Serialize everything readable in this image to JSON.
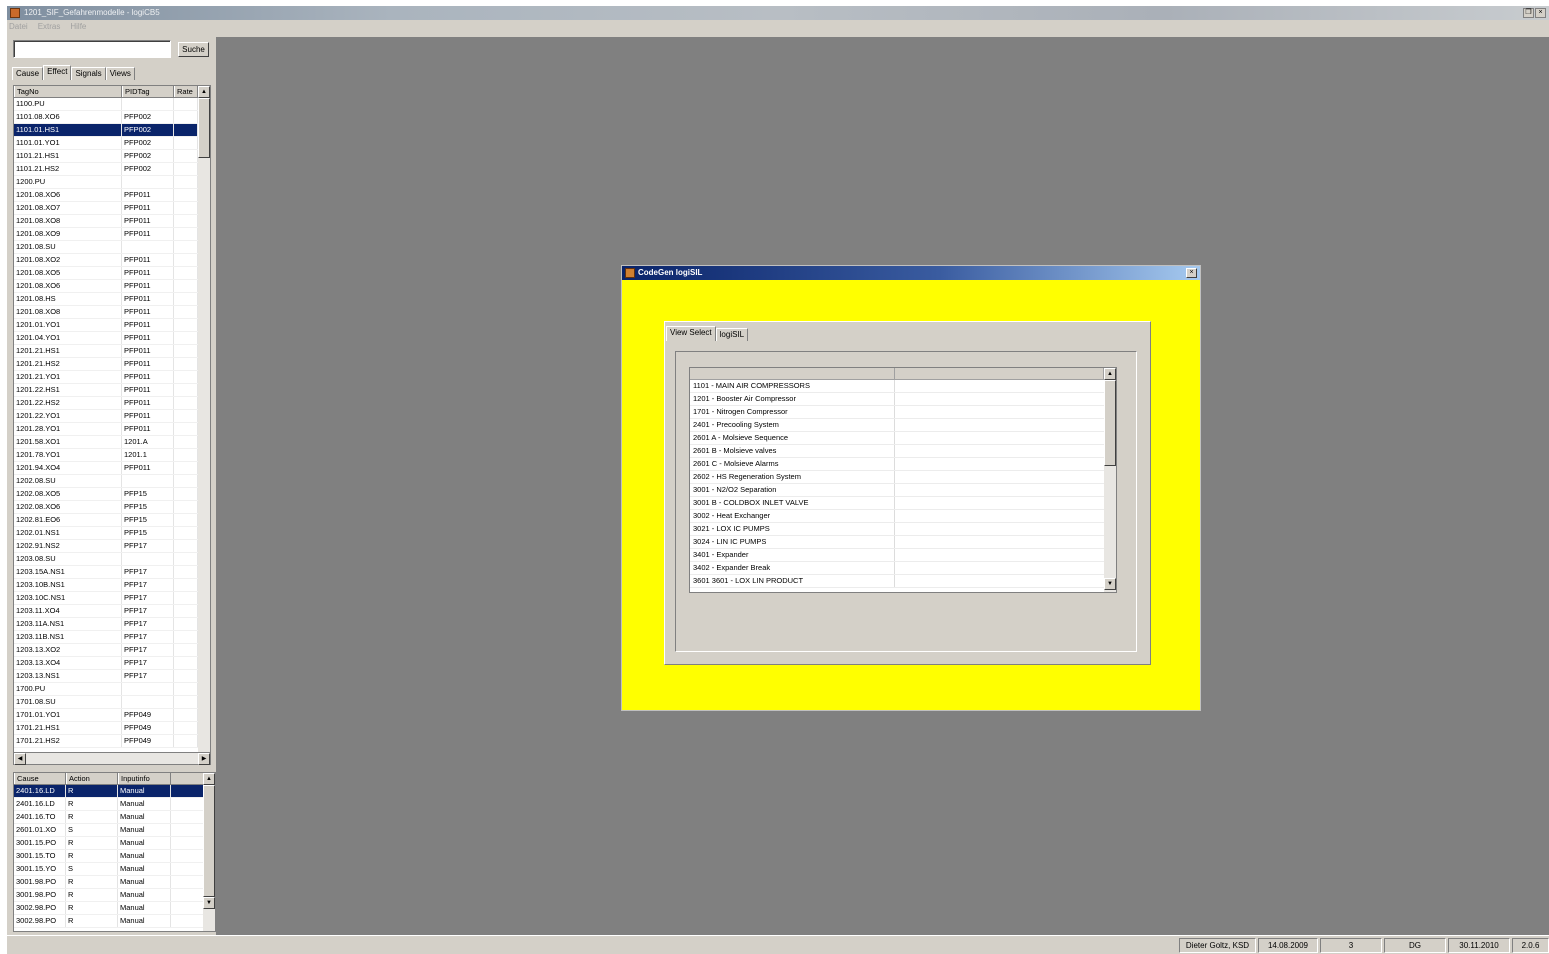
{
  "window": {
    "title": "1201_SIF_Gefahrenmodelle - logiCB5"
  },
  "menu": [
    "Datei",
    "Extras",
    "Hilfe"
  ],
  "search": {
    "value": "",
    "button_label": "Suche"
  },
  "left_tabs": [
    "Cause",
    "Effect",
    "Signals",
    "Views"
  ],
  "effect_table": {
    "columns": [
      "TagNo",
      "PIDTag",
      "Rate"
    ],
    "rows": [
      [
        "1100.PU",
        ""
      ],
      [
        "1101.08.XO6",
        "PFP002"
      ],
      [
        "1101.01.HS1",
        "PFP002"
      ],
      [
        "1101.01.YO1",
        "PFP002"
      ],
      [
        "1101.21.HS1",
        "PFP002"
      ],
      [
        "1101.21.HS2",
        "PFP002"
      ],
      [
        "1200.PU",
        ""
      ],
      [
        "1201.08.XO6",
        "PFP011"
      ],
      [
        "1201.08.XO7",
        "PFP011"
      ],
      [
        "1201.08.XO8",
        "PFP011"
      ],
      [
        "1201.08.XO9",
        "PFP011"
      ],
      [
        "1201.08.SU",
        ""
      ],
      [
        "1201.08.XO2",
        "PFP011"
      ],
      [
        "1201.08.XO5",
        "PFP011"
      ],
      [
        "1201.08.XO6",
        "PFP011"
      ],
      [
        "1201.08.HS",
        "PFP011"
      ],
      [
        "1201.08.XO8",
        "PFP011"
      ],
      [
        "1201.01.YO1",
        "PFP011"
      ],
      [
        "1201.04.YO1",
        "PFP011"
      ],
      [
        "1201.21.HS1",
        "PFP011"
      ],
      [
        "1201.21.HS2",
        "PFP011"
      ],
      [
        "1201.21.YO1",
        "PFP011"
      ],
      [
        "1201.22.HS1",
        "PFP011"
      ],
      [
        "1201.22.HS2",
        "PFP011"
      ],
      [
        "1201.22.YO1",
        "PFP011"
      ],
      [
        "1201.28.YO1",
        "PFP011"
      ],
      [
        "1201.58.XO1",
        "1201.A"
      ],
      [
        "1201.78.YO1",
        "1201.1"
      ],
      [
        "1201.94.XO4",
        "PFP011"
      ],
      [
        "1202.08.SU",
        ""
      ],
      [
        "1202.08.XO5",
        "PFP15"
      ],
      [
        "1202.08.XO6",
        "PFP15"
      ],
      [
        "1202.81.EO6",
        "PFP15"
      ],
      [
        "1202.01.NS1",
        "PFP15"
      ],
      [
        "1202.91.NS2",
        "PFP17"
      ],
      [
        "1203.08.SU",
        ""
      ],
      [
        "1203.15A.NS1",
        "PFP17"
      ],
      [
        "1203.10B.NS1",
        "PFP17"
      ],
      [
        "1203.10C.NS1",
        "PFP17"
      ],
      [
        "1203.11.XO4",
        "PFP17"
      ],
      [
        "1203.11A.NS1",
        "PFP17"
      ],
      [
        "1203.11B.NS1",
        "PFP17"
      ],
      [
        "1203.13.XO2",
        "PFP17"
      ],
      [
        "1203.13.XO4",
        "PFP17"
      ],
      [
        "1203.13.NS1",
        "PFP17"
      ],
      [
        "1700.PU",
        ""
      ],
      [
        "1701.08.SU",
        ""
      ],
      [
        "1701.01.YO1",
        "PFP049"
      ],
      [
        "1701.21.HS1",
        "PFP049"
      ],
      [
        "1701.21.HS2",
        "PFP049"
      ]
    ]
  },
  "cause_table": {
    "columns": [
      "Cause",
      "Action",
      "Inputinfo"
    ],
    "rows": [
      [
        "2401.16.LD",
        "R",
        "Manual"
      ],
      [
        "2401.16.LD",
        "R",
        "Manual"
      ],
      [
        "2401.16.TO",
        "R",
        "Manual"
      ],
      [
        "2601.01.XO",
        "S",
        "Manual"
      ],
      [
        "3001.15.PO",
        "R",
        "Manual"
      ],
      [
        "3001.15.TO",
        "R",
        "Manual"
      ],
      [
        "3001.15.YO",
        "S",
        "Manual"
      ],
      [
        "3001.98.PO",
        "R",
        "Manual"
      ],
      [
        "3001.98.PO",
        "R",
        "Manual"
      ],
      [
        "3002.98.PO",
        "R",
        "Manual"
      ],
      [
        "3002.98.PO",
        "R",
        "Manual"
      ]
    ]
  },
  "dialog": {
    "title": "CodeGen logiSIL",
    "tabs": [
      "View Select",
      "logiSIL"
    ],
    "views": [
      "1101 - MAIN AIR COMPRESSORS",
      "1201 - Booster Air Compressor",
      "1701 - Nitrogen Compressor",
      "2401 - Precooling System",
      "2601 A - Molsieve Sequence",
      "2601 B - Molsieve valves",
      "2601 C - Molsieve Alarms",
      "2602 - HS Regeneration System",
      "3001 - N2/O2 Separation",
      "3001 B - COLDBOX INLET VALVE",
      "3002 - Heat Exchanger",
      "3021 - LOX IC PUMPS",
      "3024 - LIN IC PUMPS",
      "3401 - Expander",
      "3402 - Expander Break",
      "3601 3601 - LOX LIN PRODUCT"
    ]
  },
  "status": [
    "Dieter Goltz, KSD",
    "14.08.2009",
    "3",
    "DG",
    "30.11.2010",
    "2.0.6"
  ],
  "colors": {
    "workspace": "#808080",
    "dialog_bg": "#ffff00",
    "selection": "#0a246a",
    "chrome": "#d4d0c8"
  }
}
